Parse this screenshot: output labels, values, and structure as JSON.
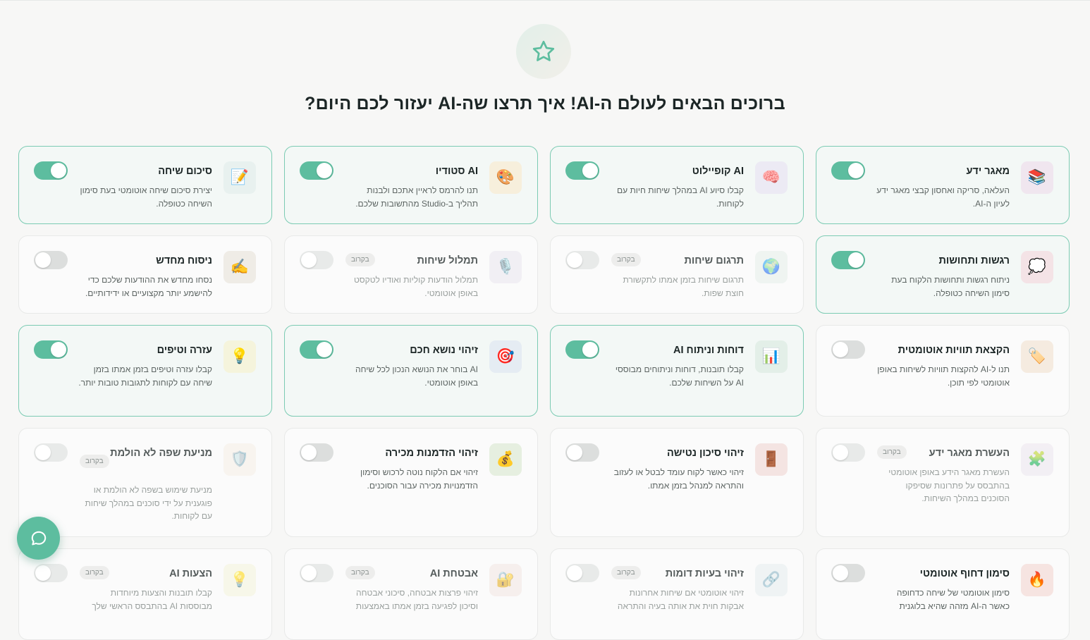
{
  "page": {
    "title": "ברוכים הבאים לעולם ה-AI! איך תרצו שה-AI יעזור לכם היום?",
    "hero_icon": "star-icon",
    "chat_button_icon": "chat-bubble-icon",
    "accent_color": "#5dbd9f"
  },
  "features": [
    {
      "id": "knowledge-base",
      "title": "מאגר ידע",
      "description": "העלאה, סריקה ואחסון קבצי מאגר ידע לעיון ה-AI.",
      "icon": "📚",
      "icon_name": "books-icon",
      "icon_bg": "#f0e6ef",
      "enabled": true,
      "soon": false
    },
    {
      "id": "ai-copilot",
      "title": "AI קופיילוט",
      "description": "קבלו סיוע AI במהלך שיחות חיות עם לקוחות.",
      "icon": "🧠",
      "icon_name": "brain-icon",
      "icon_bg": "#eceaf4",
      "enabled": true,
      "soon": false
    },
    {
      "id": "ai-studio",
      "title": "AI סטודיו",
      "description": "תנו להרמס לראיין אתכם ולבנות תהליך ב-Studio מהתשובות שלכם.",
      "icon": "🎨",
      "icon_name": "palette-icon",
      "icon_bg": "#f7efdc",
      "enabled": true,
      "soon": false
    },
    {
      "id": "conversation-summary",
      "title": "סיכום שיחה",
      "description": "יצירת סיכום שיחה אוטומטי בעת סימון השיחה כטופלה.",
      "icon": "📝",
      "icon_name": "memo-icon",
      "icon_bg": "#e8f1ef",
      "enabled": true,
      "soon": false
    },
    {
      "id": "sentiment",
      "title": "רגשות ותחושות",
      "description": "ניתוח רגשות ותחושות הלקוח בעת סימון השיחה כטופלה.",
      "icon": "💭",
      "icon_name": "thought-bubble-icon",
      "icon_bg": "#f4e3e6",
      "enabled": true,
      "soon": false
    },
    {
      "id": "translation",
      "title": "תרגום שיחות",
      "description": "תרגום שיחות בזמן אמתו לתקשורת חוצת שפות.",
      "icon": "🌍",
      "icon_name": "globe-icon",
      "icon_bg": "#e6efea",
      "enabled": false,
      "soon": true
    },
    {
      "id": "transcription",
      "title": "תמלול שיחות",
      "description": "תמלול הודעות קוליות ואודיו לטקסט באופן אוטומטי.",
      "icon": "🎙️",
      "icon_name": "microphone-icon",
      "icon_bg": "#eae6ef",
      "enabled": false,
      "soon": true
    },
    {
      "id": "rephrase",
      "title": "ניסוח מחדש",
      "description": "נסחו מחדש את ההודעות שלכם כדי להישמע יותר מקצועיים או ידידותיים.",
      "icon": "✍️",
      "icon_name": "writing-hand-icon",
      "icon_bg": "#efece6",
      "enabled": false,
      "soon": false
    },
    {
      "id": "auto-tagging",
      "title": "הקצאת תוויות אוטומטית",
      "description": "תנו ל-AI להקצות תוויות לשיחות באופן אוטומטי לפי תוכן.",
      "icon": "🏷️",
      "icon_name": "label-tag-icon",
      "icon_bg": "#f5ebe0",
      "enabled": false,
      "soon": false
    },
    {
      "id": "ai-reports",
      "title": "דוחות וניתוח AI",
      "description": "קבלו תובנות, דוחות וניתוחים מבוססי AI על השיחות שלכם.",
      "icon": "📊",
      "icon_name": "bar-chart-icon",
      "icon_bg": "#e3efe8",
      "enabled": true,
      "soon": false
    },
    {
      "id": "smart-topic",
      "title": "זיהוי נושא חכם",
      "description": "AI בוחר את הנושא הנכון לכל שיחה באופן אוטומטי.",
      "icon": "🎯",
      "icon_name": "target-icon",
      "icon_bg": "#e5ecf3",
      "enabled": true,
      "soon": false
    },
    {
      "id": "help-tips",
      "title": "עזרה וטיפים",
      "description": "קבלו עזרה וטיפים בזמן אמתו בזמן שיחה עם לקוחות לתגובות טובות יותר.",
      "icon": "💡",
      "icon_name": "light-bulb-icon",
      "icon_bg": "#f5f4dc",
      "enabled": true,
      "soon": false
    },
    {
      "id": "kb-enrichment",
      "title": "העשרת מאגר ידע",
      "description": "העשרת מאגר הידע באופן אוטומטי בהתבסס על פתרונות שסיפקו הסוכנים במהלך השיחות.",
      "icon": "🧩",
      "icon_name": "puzzle-icon",
      "icon_bg": "#ece6ef",
      "enabled": false,
      "soon": true
    },
    {
      "id": "churn-risk",
      "title": "זיהוי סיכון נטישה",
      "description": "זיהוי כאשר לקוח עומד לבטל או לעזוב והתראה למנהל בזמן אמתו.",
      "icon": "🚪",
      "icon_name": "door-icon",
      "icon_bg": "#f4e4e2",
      "enabled": false,
      "soon": false
    },
    {
      "id": "sales-opportunity",
      "title": "זיהוי הזדמנות מכירה",
      "description": "זיהוי אם הלקוח נוטה לרכוש וסימון הזדמנויות מכירה עבור הסוכנים.",
      "icon": "💰",
      "icon_name": "money-bag-icon",
      "icon_bg": "#e6efe0",
      "enabled": false,
      "soon": false
    },
    {
      "id": "profanity",
      "title": "מניעת שפה לא הולמת",
      "description": "מניעת שימוש בשפה לא הולמת או פוגענית על ידי סוכנים במהלך שיחות עם לקוחות.",
      "icon": "🛡️",
      "icon_name": "shield-icon",
      "icon_bg": "#f6efe6",
      "enabled": false,
      "soon": true
    },
    {
      "id": "urgent-flag",
      "title": "סימון דחוף אוטומטי",
      "description": "סימון אוטומטי של שיחה כדחופה כאשר ה-AI מזהה שהיא בלוגנית",
      "icon": "🔥",
      "icon_name": "fire-icon",
      "icon_bg": "#f6e4e1",
      "enabled": false,
      "soon": false
    },
    {
      "id": "similar-issues",
      "title": "זיהוי בעיות דומות",
      "description": "זיהוי אוטומטי אם שיחות אחרונות אבקות חוית את אותה בעיה והתראה",
      "icon": "🔗",
      "icon_name": "link-icon",
      "icon_bg": "#e6eef0",
      "enabled": false,
      "soon": true
    },
    {
      "id": "ai-security",
      "title": "אבטחת AI",
      "description": "זיהוי פרצות אבטחה, סיכוני אבטחה וסיכון לפגיעה בזמן אמתו באמצעות",
      "icon": "🔐",
      "icon_name": "lock-key-icon",
      "icon_bg": "#f3e6e2",
      "enabled": false,
      "soon": true
    },
    {
      "id": "ai-suggestions",
      "title": "הצעות AI",
      "description": "קבלו תובנות והצעות מיוחדות מבוססות AI בהתבסס הראשי שלך",
      "icon": "💡",
      "icon_name": "light-bulb-icon",
      "icon_bg": "#f5f4dc",
      "enabled": false,
      "soon": true
    }
  ],
  "labels": {
    "soon_badge": "בקרוב"
  }
}
